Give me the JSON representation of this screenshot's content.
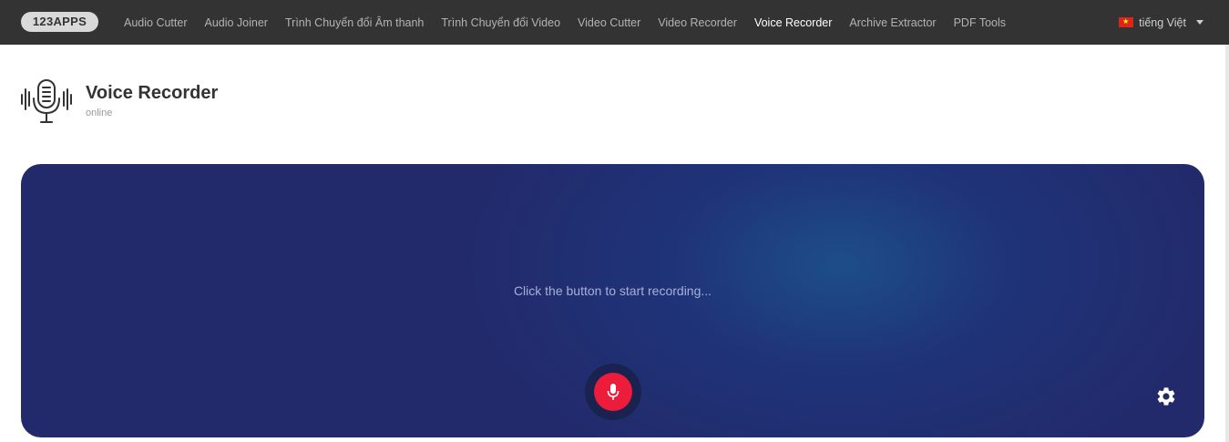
{
  "header": {
    "logo": "123APPS",
    "nav": [
      {
        "label": "Audio Cutter",
        "active": false
      },
      {
        "label": "Audio Joiner",
        "active": false
      },
      {
        "label": "Trình Chuyển đổi Âm thanh",
        "active": false
      },
      {
        "label": "Trình Chuyển đổi Video",
        "active": false
      },
      {
        "label": "Video Cutter",
        "active": false
      },
      {
        "label": "Video Recorder",
        "active": false
      },
      {
        "label": "Voice Recorder",
        "active": true
      },
      {
        "label": "Archive Extractor",
        "active": false
      },
      {
        "label": "PDF Tools",
        "active": false
      }
    ],
    "language": {
      "label": "tiếng Việt",
      "flag_icon": "vietnam-flag-icon"
    }
  },
  "app": {
    "title": "Voice Recorder",
    "subtitle": "online",
    "icon": "microphone-waveform-icon"
  },
  "recorder": {
    "prompt": "Click the button to start recording...",
    "record_icon": "microphone-icon",
    "settings_icon": "gear-icon"
  },
  "colors": {
    "topbar": "#333333",
    "stage": "#222a6b",
    "record": "#ec1c3a"
  }
}
